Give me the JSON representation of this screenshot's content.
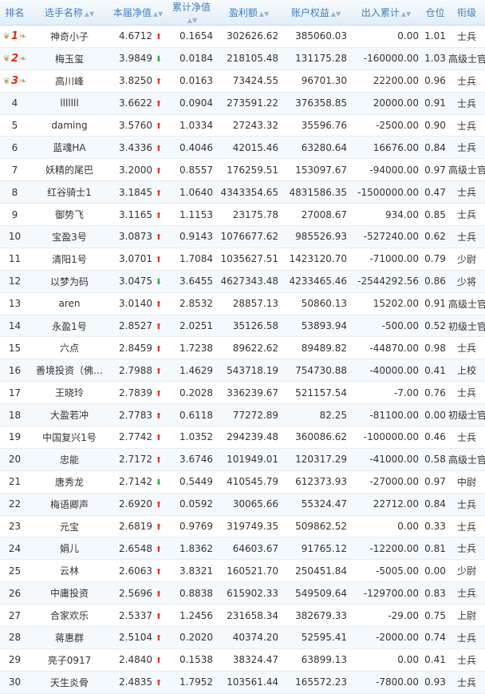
{
  "headers": {
    "rank": "排名",
    "name": "选手名称",
    "nav": "本届净值",
    "cum_nav": "累计净值",
    "profit": "盈利额",
    "equity": "账户权益",
    "inout": "出入累计",
    "position": "仓位",
    "grade": "衔级"
  },
  "rows": [
    {
      "rank": "1",
      "name": "神奇小子",
      "nav": "4.6712",
      "dir": "up",
      "cum": "0.1654",
      "profit": "302626.62",
      "equity": "385060.03",
      "inout": "0.00",
      "pos": "1.01",
      "grade": "士兵"
    },
    {
      "rank": "2",
      "name": "梅玉玺",
      "nav": "3.9849",
      "dir": "down",
      "cum": "0.0184",
      "profit": "218105.48",
      "equity": "131175.28",
      "inout": "-160000.00",
      "pos": "1.03",
      "grade": "高级士官"
    },
    {
      "rank": "3",
      "name": "高川峰",
      "nav": "3.8250",
      "dir": "up",
      "cum": "0.0163",
      "profit": "73424.55",
      "equity": "96701.30",
      "inout": "22200.00",
      "pos": "0.96",
      "grade": "士兵"
    },
    {
      "rank": "4",
      "name": "lllllll",
      "nav": "3.6622",
      "dir": "up",
      "cum": "0.0904",
      "profit": "273591.22",
      "equity": "376358.85",
      "inout": "20000.00",
      "pos": "0.91",
      "grade": "士兵"
    },
    {
      "rank": "5",
      "name": "daming",
      "nav": "3.5760",
      "dir": "up",
      "cum": "1.0334",
      "profit": "27243.32",
      "equity": "35596.76",
      "inout": "-2500.00",
      "pos": "0.90",
      "grade": "士兵"
    },
    {
      "rank": "6",
      "name": "蓝魂HA",
      "nav": "3.4336",
      "dir": "up",
      "cum": "0.4046",
      "profit": "42015.46",
      "equity": "63280.64",
      "inout": "16676.00",
      "pos": "0.84",
      "grade": "士兵"
    },
    {
      "rank": "7",
      "name": "妖精的尾巴",
      "nav": "3.2000",
      "dir": "up",
      "cum": "0.8557",
      "profit": "176259.51",
      "equity": "153097.67",
      "inout": "-94000.00",
      "pos": "0.97",
      "grade": "高级士官"
    },
    {
      "rank": "8",
      "name": "红谷骑士1",
      "nav": "3.1845",
      "dir": "up",
      "cum": "1.0640",
      "profit": "4343354.65",
      "equity": "4831586.35",
      "inout": "-1500000.00",
      "pos": "0.47",
      "grade": "士兵"
    },
    {
      "rank": "9",
      "name": "御势飞",
      "nav": "3.1165",
      "dir": "up",
      "cum": "1.1153",
      "profit": "23175.78",
      "equity": "27008.67",
      "inout": "934.00",
      "pos": "0.85",
      "grade": "士兵"
    },
    {
      "rank": "10",
      "name": "宝盈3号",
      "nav": "3.0873",
      "dir": "up",
      "cum": "0.9143",
      "profit": "1076677.62",
      "equity": "985526.93",
      "inout": "-527240.00",
      "pos": "0.62",
      "grade": "士兵"
    },
    {
      "rank": "11",
      "name": "清阳1号",
      "nav": "3.0701",
      "dir": "up",
      "cum": "1.7084",
      "profit": "1035627.51",
      "equity": "1423120.70",
      "inout": "-71000.00",
      "pos": "0.79",
      "grade": "少尉"
    },
    {
      "rank": "12",
      "name": "以梦为码",
      "nav": "3.0475",
      "dir": "down",
      "cum": "3.6455",
      "profit": "4627343.48",
      "equity": "4233465.46",
      "inout": "-2544292.56",
      "pos": "0.86",
      "grade": "少将"
    },
    {
      "rank": "13",
      "name": "aren",
      "nav": "3.0140",
      "dir": "up",
      "cum": "2.8532",
      "profit": "28857.13",
      "equity": "50860.13",
      "inout": "15202.00",
      "pos": "0.91",
      "grade": "高级士官"
    },
    {
      "rank": "14",
      "name": "永盈1号",
      "nav": "2.8527",
      "dir": "up",
      "cum": "2.0251",
      "profit": "35126.58",
      "equity": "53893.94",
      "inout": "-500.00",
      "pos": "0.52",
      "grade": "初级士官"
    },
    {
      "rank": "15",
      "name": "六点",
      "nav": "2.8459",
      "dir": "up",
      "cum": "1.7238",
      "profit": "89622.62",
      "equity": "89489.82",
      "inout": "-44870.00",
      "pos": "0.98",
      "grade": "士兵"
    },
    {
      "rank": "16",
      "name": "善境投资（佛…",
      "nav": "2.7988",
      "dir": "up",
      "cum": "1.4629",
      "profit": "543718.19",
      "equity": "754730.88",
      "inout": "-40000.00",
      "pos": "0.41",
      "grade": "上校"
    },
    {
      "rank": "17",
      "name": "王晓玲",
      "nav": "2.7839",
      "dir": "up",
      "cum": "0.2028",
      "profit": "336239.67",
      "equity": "521157.54",
      "inout": "-7.00",
      "pos": "0.76",
      "grade": "士兵"
    },
    {
      "rank": "18",
      "name": "大盈若冲",
      "nav": "2.7783",
      "dir": "up",
      "cum": "0.6118",
      "profit": "77272.89",
      "equity": "82.25",
      "inout": "-81100.00",
      "pos": "0.00",
      "grade": "初级士官"
    },
    {
      "rank": "19",
      "name": "中国复兴1号",
      "nav": "2.7742",
      "dir": "up",
      "cum": "1.0352",
      "profit": "294239.48",
      "equity": "360086.62",
      "inout": "-100000.00",
      "pos": "0.46",
      "grade": "士兵"
    },
    {
      "rank": "20",
      "name": "忠能",
      "nav": "2.7172",
      "dir": "up",
      "cum": "3.6746",
      "profit": "101949.01",
      "equity": "120317.29",
      "inout": "-41000.00",
      "pos": "0.58",
      "grade": "高级士官"
    },
    {
      "rank": "21",
      "name": "唐秀龙",
      "nav": "2.7142",
      "dir": "down",
      "cum": "0.5449",
      "profit": "410545.79",
      "equity": "612373.93",
      "inout": "-27000.00",
      "pos": "0.97",
      "grade": "中尉"
    },
    {
      "rank": "22",
      "name": "梅语卿声",
      "nav": "2.6920",
      "dir": "up",
      "cum": "0.0592",
      "profit": "30065.66",
      "equity": "55324.47",
      "inout": "22712.00",
      "pos": "0.84",
      "grade": "士兵"
    },
    {
      "rank": "23",
      "name": "元宝",
      "nav": "2.6819",
      "dir": "up",
      "cum": "0.9769",
      "profit": "319749.35",
      "equity": "509862.52",
      "inout": "0.00",
      "pos": "0.33",
      "grade": "士兵"
    },
    {
      "rank": "24",
      "name": "娟儿",
      "nav": "2.6548",
      "dir": "up",
      "cum": "1.8362",
      "profit": "64603.67",
      "equity": "91765.12",
      "inout": "-12200.00",
      "pos": "0.81",
      "grade": "士兵"
    },
    {
      "rank": "25",
      "name": "云林",
      "nav": "2.6063",
      "dir": "up",
      "cum": "3.8321",
      "profit": "160521.70",
      "equity": "250451.84",
      "inout": "-5005.00",
      "pos": "0.00",
      "grade": "少尉"
    },
    {
      "rank": "26",
      "name": "中庸投资",
      "nav": "2.5696",
      "dir": "up",
      "cum": "0.8838",
      "profit": "615902.33",
      "equity": "549509.64",
      "inout": "-129700.00",
      "pos": "0.83",
      "grade": "士兵"
    },
    {
      "rank": "27",
      "name": "合家欢乐",
      "nav": "2.5337",
      "dir": "up",
      "cum": "1.2456",
      "profit": "231658.34",
      "equity": "382679.33",
      "inout": "-29.00",
      "pos": "0.75",
      "grade": "上尉"
    },
    {
      "rank": "28",
      "name": "蒋惠群",
      "nav": "2.5104",
      "dir": "up",
      "cum": "0.2020",
      "profit": "40374.20",
      "equity": "52595.41",
      "inout": "-2000.00",
      "pos": "0.74",
      "grade": "士兵"
    },
    {
      "rank": "29",
      "name": "亮子0917",
      "nav": "2.4840",
      "dir": "up",
      "cum": "0.1538",
      "profit": "38324.47",
      "equity": "63899.13",
      "inout": "0.00",
      "pos": "0.41",
      "grade": "士兵"
    },
    {
      "rank": "30",
      "name": "天生炎骨",
      "nav": "2.4835",
      "dir": "up",
      "cum": "1.7952",
      "profit": "103561.44",
      "equity": "165572.23",
      "inout": "-7800.00",
      "pos": "0.93",
      "grade": "士兵"
    }
  ],
  "icons": {
    "up": "arrow-up-icon",
    "down": "arrow-down-icon",
    "medal": "wings-medal-icon"
  },
  "colors": {
    "up": "#e03a2b",
    "down": "#2fa83a",
    "header_text": "#3f7fbf",
    "medal_number": "#d32c1c"
  }
}
